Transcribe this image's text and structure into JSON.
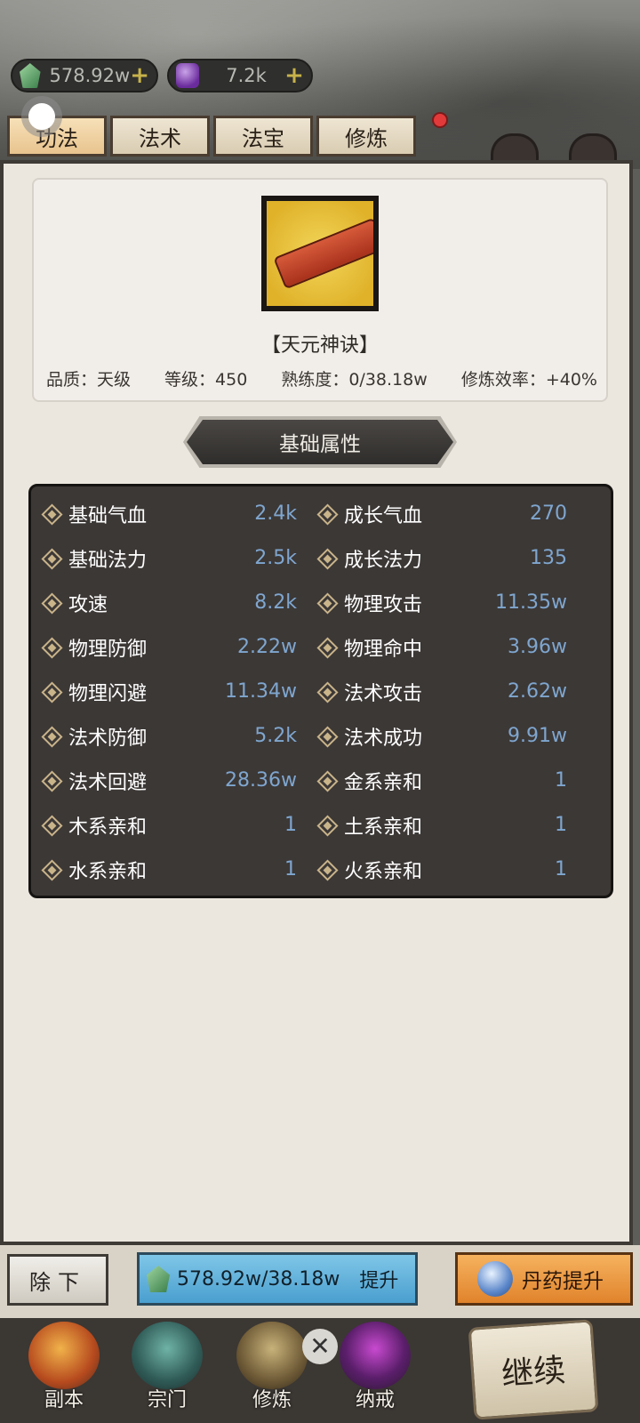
{
  "currency": {
    "jade": {
      "value": "578.92w",
      "icon": "jade-icon"
    },
    "gem": {
      "value": "7.2k",
      "icon": "purple-gem-icon"
    }
  },
  "tabs": [
    {
      "label": "功法",
      "active": true
    },
    {
      "label": "法术",
      "active": false
    },
    {
      "label": "法宝",
      "active": false
    },
    {
      "label": "修炼",
      "active": false
    }
  ],
  "item": {
    "name": "【天元神诀】",
    "quality": "品质：天级",
    "level": "等级：450",
    "proficiency": "熟练度：0/38.18w",
    "efficiency": "修炼效率：+40%"
  },
  "section_title": "基础属性",
  "attributes": [
    {
      "left_label": "基础气血",
      "left_value": "2.4k",
      "right_label": "成长气血",
      "right_value": "270"
    },
    {
      "left_label": "基础法力",
      "left_value": "2.5k",
      "right_label": "成长法力",
      "right_value": "135"
    },
    {
      "left_label": "攻速",
      "left_value": "8.2k",
      "right_label": "物理攻击",
      "right_value": "11.35w"
    },
    {
      "left_label": "物理防御",
      "left_value": "2.22w",
      "right_label": "物理命中",
      "right_value": "3.96w"
    },
    {
      "left_label": "物理闪避",
      "left_value": "11.34w",
      "right_label": "法术攻击",
      "right_value": "2.62w"
    },
    {
      "left_label": "法术防御",
      "left_value": "5.2k",
      "right_label": "法术成功",
      "right_value": "9.91w"
    },
    {
      "left_label": "法术回避",
      "left_value": "28.36w",
      "right_label": "金系亲和",
      "right_value": "1"
    },
    {
      "left_label": "木系亲和",
      "left_value": "1",
      "right_label": "土系亲和",
      "right_value": "1"
    },
    {
      "left_label": "水系亲和",
      "left_value": "1",
      "right_label": "火系亲和",
      "right_value": "1"
    }
  ],
  "actions": {
    "remove_label": "除下",
    "upgrade_cost": "578.92w/38.18w",
    "upgrade_label": "提升",
    "pill_upgrade_label": "丹药提升"
  },
  "nav": [
    {
      "label": "副本",
      "icon": "dungeon-icon"
    },
    {
      "label": "宗门",
      "icon": "sect-icon"
    },
    {
      "label": "修炼",
      "icon": "cultivate-icon"
    },
    {
      "label": "纳戒",
      "icon": "ring-icon"
    }
  ],
  "continue_label": "继续",
  "colors": {
    "value_blue": "#7fa6cf",
    "panel_bg": "#ece7de",
    "attr_bg": "#3c3836"
  }
}
